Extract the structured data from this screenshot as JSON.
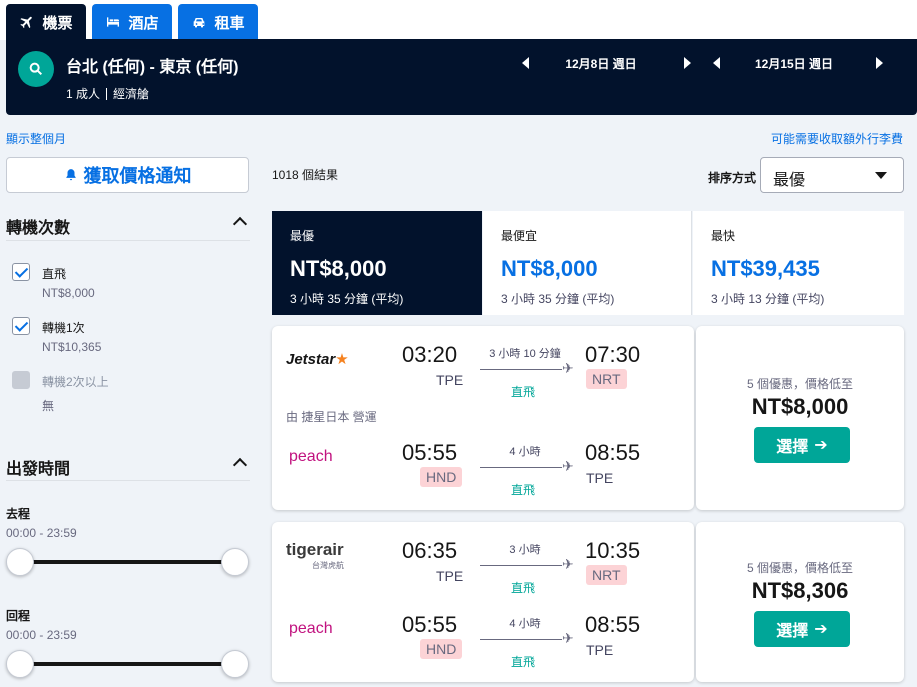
{
  "tabs": [
    {
      "label": "機票",
      "icon": "plane-icon"
    },
    {
      "label": "酒店",
      "icon": "bed-icon"
    },
    {
      "label": "租車",
      "icon": "car-icon"
    }
  ],
  "search": {
    "route": "台北 (任何) - 東京 (任何)",
    "passengers": "1 成人",
    "cabin": "經濟艙",
    "depart_date": "12月8日 週日",
    "return_date": "12月15日 週日"
  },
  "links": {
    "whole_month": "顯示整個月",
    "baggage_fees": "可能需要收取額外行李費"
  },
  "price_alert": "獲取價格通知",
  "filters": {
    "stops_title": "轉機次數",
    "stops": [
      {
        "label": "直飛",
        "price": "NT$8,000",
        "checked": true,
        "disabled": false
      },
      {
        "label": "轉機1次",
        "price": "NT$10,365",
        "checked": true,
        "disabled": false
      },
      {
        "label": "轉機2次以上",
        "price": "無",
        "checked": false,
        "disabled": true
      }
    ],
    "departure_title": "出發時間",
    "outbound_label": "去程",
    "outbound_range": "00:00 - 23:59",
    "return_label": "回程",
    "return_range": "00:00 - 23:59"
  },
  "results": {
    "count": "1018 個結果",
    "sort_label": "排序方式",
    "sort_value": "最優"
  },
  "sort_cards": [
    {
      "label": "最優",
      "price": "NT$8,000",
      "duration": "3 小時 35 分鐘 (平均)",
      "active": true
    },
    {
      "label": "最便宜",
      "price": "NT$8,000",
      "duration": "3 小時 35 分鐘 (平均)",
      "active": false
    },
    {
      "label": "最快",
      "price": "NT$39,435",
      "duration": "3 小時 13 分鐘 (平均)",
      "active": false
    }
  ],
  "tickets": [
    {
      "legs": [
        {
          "airline": "Jetstar",
          "depart": "03:20",
          "from": "TPE",
          "duration": "3 小時 10 分鐘",
          "stops": "直飛",
          "arrive": "07:30",
          "to": "NRT"
        },
        {
          "airline": "peach",
          "depart": "05:55",
          "from": "HND",
          "duration": "4 小時",
          "stops": "直飛",
          "arrive": "08:55",
          "to": "TPE"
        }
      ],
      "operated_by": "由 捷星日本 營運",
      "deals": "5 個優惠，價格低至",
      "price": "NT$8,000",
      "select": "選擇"
    },
    {
      "legs": [
        {
          "airline": "tigerair",
          "airline_sub": "台灣虎航",
          "depart": "06:35",
          "from": "TPE",
          "duration": "3 小時",
          "stops": "直飛",
          "arrive": "10:35",
          "to": "NRT"
        },
        {
          "airline": "peach",
          "depart": "05:55",
          "from": "HND",
          "duration": "4 小時",
          "stops": "直飛",
          "arrive": "08:55",
          "to": "TPE"
        }
      ],
      "deals": "5 個優惠，價格低至",
      "price": "NT$8,306",
      "select": "選擇"
    }
  ],
  "colors": {
    "navy": "#02122c",
    "blue": "#0770e3",
    "teal": "#00a698",
    "jetstar": "#f58220",
    "peach": "#c1127f",
    "tiger": "#f5a000"
  }
}
